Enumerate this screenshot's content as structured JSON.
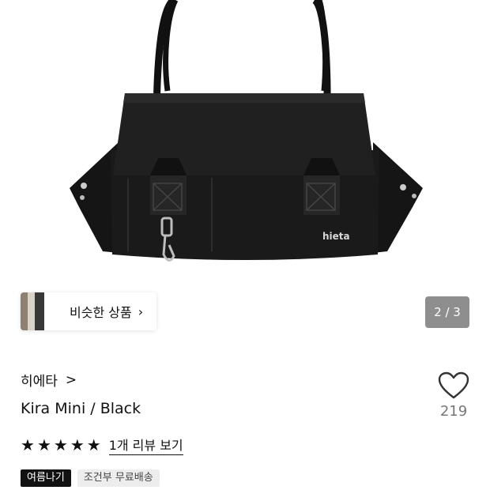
{
  "product_image": {
    "brand_stamp": "hieta"
  },
  "similar_products": {
    "label": "비슷한 상품",
    "chevron": "›"
  },
  "gallery": {
    "indicator": "2 / 3"
  },
  "product": {
    "brand": "히에타",
    "brand_chevron": ">",
    "title": "Kira Mini / Black",
    "likes": "219",
    "rating_stars": 5,
    "review_link": "1개 리뷰 보기",
    "badges": [
      "여름나기",
      "조건부 무료배송"
    ]
  },
  "icons": {
    "like": "heart-outline-icon",
    "rating": "star-icon"
  },
  "colors": {
    "text": "#111111",
    "muted": "#777777",
    "indicator_bg": "#8e8e8e"
  }
}
